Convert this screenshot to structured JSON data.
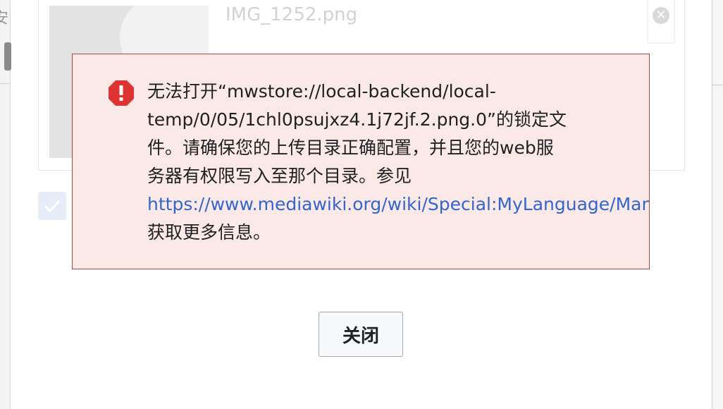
{
  "background": {
    "left_fragment_text": "安",
    "upload_item": {
      "filename": "IMG_1252.png"
    }
  },
  "error_message": {
    "line_1": "无法打开“mwstore://local-backend/local-",
    "line_2": "temp/0/05/1chl0psujxz4.1j72jf.2.png.0”的锁定文",
    "line_3": "件。请确保您的上传目录正确配置，并且您的web服",
    "line_4": "务器有权限写入至那个目录。参见",
    "link": "https://www.mediawiki.org/wiki/Special:MyLanguage/Manual:$wgUploadDirectory",
    "line_6": "获取更多信息。",
    "colors": {
      "border": "#a9483c",
      "background": "#fbe9e7",
      "icon": "#d33",
      "link": "#3366cc"
    }
  },
  "dialog": {
    "close_label": "关闭"
  }
}
